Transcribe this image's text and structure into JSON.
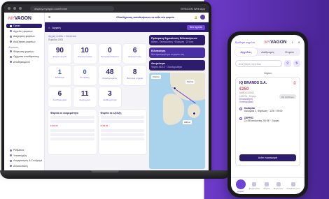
{
  "laptop": {
    "url": "display.myagon.com/home",
    "browser_right": "MYAGON Web App",
    "logo": {
      "part1": "MY",
      "part2": "VAGON"
    },
    "sidebar": [
      {
        "label": "Πρακτ",
        "active": true
      },
      {
        "label": "Αγγελίες φορτίων",
        "active": false
      },
      {
        "label": "Διαχείριση φορτίων",
        "active": false
      },
      {
        "label": "Αναζήτηση φορτίων",
        "active": false
      }
    ],
    "sidebar_group": "Φόρτωση",
    "sidebar_sub": [
      "Φόρτωση φορτίων",
      "Οχήματα αποθήκευσης",
      "Αποθηκευμένα"
    ],
    "sidebar_bottom": [
      "Ρυθμίσεις",
      "Υποστήριξη",
      "Λογαριασμός & Συνδρομές",
      "Αποσύνδεση"
    ],
    "topbar_promo": "Ολοκλήρωση τοποθετήσεων σε κάθε νέο φορτίο",
    "subbar_title": "Αρχική",
    "subbar_btn": "Νέα αγγελία",
    "crumbs": "Αρχική σελίδα > Στατιστικά",
    "period": "Περίοδος 2023",
    "stats": [
      {
        "num": "90",
        "lbl": "Ενεργά φορτία",
        "blue": false
      },
      {
        "num": "10",
        "lbl": "Ολοκληρωμένα",
        "blue": false
      },
      {
        "num": "0",
        "lbl": "Προγραμματισμένα",
        "blue": false
      },
      {
        "num": "6",
        "lbl": "Εκκρεμότητες",
        "blue": false
      },
      {
        "num": "1",
        "lbl": "Διαθέσιμα",
        "blue": true
      },
      {
        "num": "0",
        "lbl": "Σε εξέλιξη",
        "blue": true
      },
      {
        "num": "48",
        "lbl": "Ολοκληρωμένες",
        "blue": false
      },
      {
        "num": "8",
        "lbl": "Φόρτωσε σήμερα",
        "blue": false
      },
      {
        "num": "6",
        "lbl": "Αποθηκευμένα",
        "blue": false
      },
      {
        "num": "11",
        "lbl": "Ακυρωμένα",
        "blue": false
      },
      {
        "num": "3",
        "lbl": "Διαθεσιμότητα",
        "blue": false
      }
    ],
    "card1": {
      "title": "Φορτία σε εκκρεμότητα",
      "price": "€100.00"
    },
    "card2": {
      "title": "Φορτία σε εξέλιξη",
      "price": "€150.00"
    },
    "notifs": [
      {
        "hd": "Πρόσφατη δημοσίευση Ειδοποιήσεων",
        "sub": "Αθήνα - Θεσσαλονίκη · Φόρτωση · 22 Ιουν"
      },
      {
        "hd": "Ειδοποίηση",
        "sub": "Νέα προσφορά για το φορτίο σας"
      },
      {
        "hd": "Δεσμεύτηκε",
        "sub": "Φορτίο 45213 · Ολοκληρώθηκε"
      }
    ],
    "map_tags": [
      "Χάρτης",
      "Σκόπια",
      "Αθήνα"
    ]
  },
  "phone": {
    "status": "Βρέθηκε αγγελία",
    "logo": {
      "part1": "MY",
      "part2": "VAGON"
    },
    "tabs": [
      {
        "label": "Αγγελίες",
        "active": true
      },
      {
        "label": "Διαδρομές",
        "active": false
      },
      {
        "label": "Φορτία",
        "active": false
      }
    ],
    "search_placeholder": "Αναζήτηση αγγελίας",
    "section": "Κύρια",
    "card": {
      "company": "IQ BRANDS S.A.",
      "price": "€250",
      "ref": "#ΑΦΩ-102543",
      "meta": "12/6 Τετ., 15 μέρ.",
      "pill": "Μη διαθέσιμο",
      "link1": "Επισκόπηση",
      "link2": "Λεπτομέρειες",
      "stop1_title": "Καλαμάκι",
      "stop1_text": "Καλαμάκι 2, Φόρτωση · 12/6 · 09:00",
      "stop2_title": "ΣΕΡΡΕΣ",
      "stop2_text": "Σε ΘΕσσαλονίκη 2/6 ΚΕ · Σέρρες",
      "button": "Δείτε προσφορά"
    },
    "nav": [
      {
        "label": "Αρχική",
        "active": true
      },
      {
        "label": "Φορτώματα",
        "active": false
      },
      {
        "label": "Φορτία",
        "active": false
      },
      {
        "label": "Μηνύματα",
        "active": false
      },
      {
        "label": "Ρυθμίσεις μου",
        "active": false
      }
    ]
  }
}
